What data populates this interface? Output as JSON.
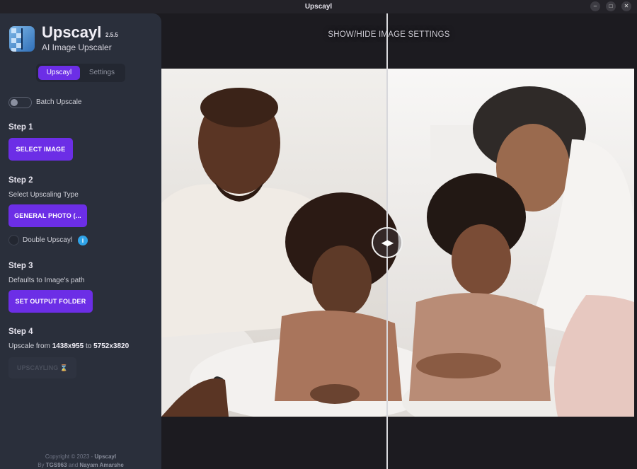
{
  "window": {
    "title": "Upscayl",
    "controls": {
      "minimize": "–",
      "maximize": "□",
      "close": "✕"
    }
  },
  "sidebar": {
    "app_name": "Upscayl",
    "version": "2.5.5",
    "subtitle": "AI Image Upscaler",
    "tabs": [
      {
        "label": "Upscayl",
        "active": true
      },
      {
        "label": "Settings",
        "active": false
      }
    ],
    "batch_upscale_label": "Batch Upscale",
    "step1": {
      "title": "Step 1",
      "button": "SELECT IMAGE"
    },
    "step2": {
      "title": "Step 2",
      "desc": "Select Upscaling Type",
      "button": "GENERAL PHOTO (...",
      "double_label": "Double Upscayl",
      "info_icon_glyph": "i"
    },
    "step3": {
      "title": "Step 3",
      "desc": "Defaults to Image's path",
      "button": "SET OUTPUT FOLDER"
    },
    "step4": {
      "title": "Step 4",
      "prefix": "Upscale from",
      "from": "1438x955",
      "mid": "to",
      "to": "5752x3820",
      "button": "UPSCAYLING ⌛"
    },
    "footer": {
      "copyright_prefix": "Copyright © 2023 -",
      "copyright_name": "Upscayl",
      "by": "By",
      "author1": "TGS963",
      "and": "and",
      "author2": "Nayam Amarshe"
    }
  },
  "main": {
    "settings_toggle": "SHOW/HIDE IMAGE SETTINGS",
    "compare_handle_glyph": "◀▶",
    "image_description": "family photo comparison, before/after",
    "slider_position_fraction": 0.476
  },
  "colors": {
    "accent": "#6c2ee6",
    "sidebar_bg": "#2a2f3b",
    "main_bg": "#1c1b20",
    "info": "#2fa3e8"
  },
  "icons": [
    "app-logo-icon",
    "minimize-icon",
    "maximize-icon",
    "close-icon",
    "info-icon",
    "compare-slider-icon",
    "hourglass-icon"
  ]
}
